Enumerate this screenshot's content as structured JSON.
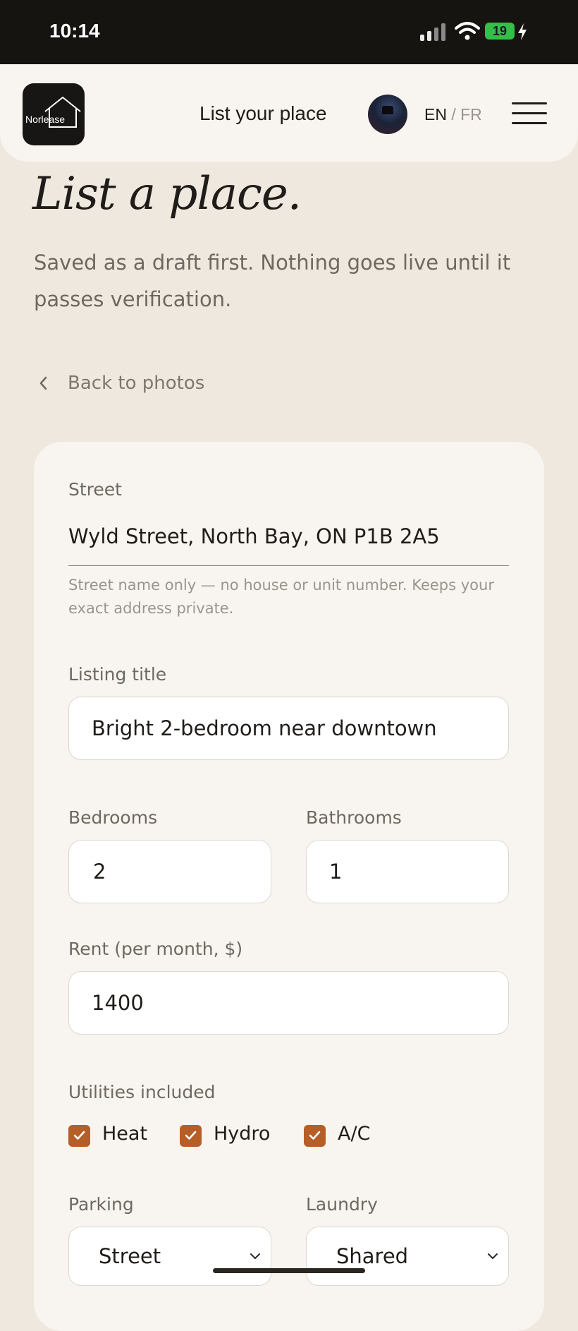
{
  "status_bar": {
    "time": "10:14",
    "battery": "19"
  },
  "header": {
    "logo_text": "Norlease",
    "nav_link": "List your place",
    "lang_en": "EN",
    "lang_sep": "/",
    "lang_fr": "FR"
  },
  "page": {
    "title": "List a place.",
    "subtitle": "Saved as a draft first. Nothing goes live until it passes verification.",
    "back_link": "Back to photos"
  },
  "form": {
    "street_label": "Street",
    "street_value": "Wyld Street, North Bay, ON P1B 2A5",
    "street_hint": "Street name only — no house or unit number. Keeps your exact address private.",
    "title_label": "Listing title",
    "title_value": "Bright 2-bedroom near downtown",
    "bedrooms_label": "Bedrooms",
    "bedrooms_value": "2",
    "bathrooms_label": "Bathrooms",
    "bathrooms_value": "1",
    "rent_label": "Rent (per month, $)",
    "rent_value": "1400",
    "utilities_label": "Utilities included",
    "utilities": [
      {
        "label": "Heat",
        "checked": true
      },
      {
        "label": "Hydro",
        "checked": true
      },
      {
        "label": "A/C",
        "checked": true
      }
    ],
    "parking_label": "Parking",
    "parking_value": "Street",
    "laundry_label": "Laundry",
    "laundry_value": "Shared"
  },
  "colors": {
    "background": "#efe8df",
    "card": "#f8f5f0",
    "accent": "#b55e27",
    "status_bar": "#161411"
  }
}
